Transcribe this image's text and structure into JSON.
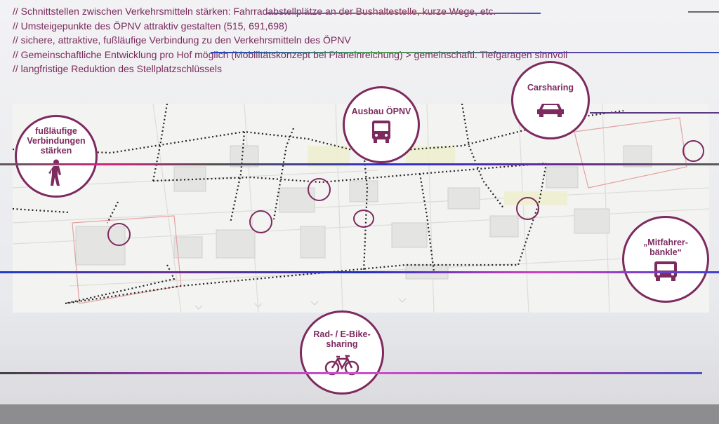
{
  "notes": [
    "// Schnittstellen zwischen Verkehrsmitteln stärken: Fahrradabstellplätze an der Bushaltestelle, kurze Wege, etc.",
    "// Umsteigepunkte des ÖPNV attraktiv gestalten (515, 691,698)",
    "// sichere, attraktive, fußläufige Verbindung zu den Verkehrsmitteln des ÖPNV",
    "// Gemeinschaftliche Entwicklung pro Hof möglich (Mobilitätskonzept bei Planeinreichung) > gemeinschaftl. Tiefgaragen sinnvoll",
    "// langfristige Reduktion des Stellplatzschlüssels"
  ],
  "bubbles": {
    "walk": {
      "label": "fußläufige\nVerbindungen\nstärken",
      "icon": "pedestrian-icon"
    },
    "transit": {
      "label": "Ausbau ÖPNV",
      "icon": "bus-icon"
    },
    "carsharing": {
      "label": "Carsharing",
      "icon": "car-icon"
    },
    "rideshare": {
      "label": "„Mitfahrer-\nbänkle“",
      "icon": "van-icon"
    },
    "bike": {
      "label": "Rad- / E-Bike-\nsharing",
      "icon": "bicycle-icon"
    }
  },
  "colors": {
    "accent": "#7d2a5f",
    "text": "#7a2a5c",
    "path": "#222222"
  }
}
